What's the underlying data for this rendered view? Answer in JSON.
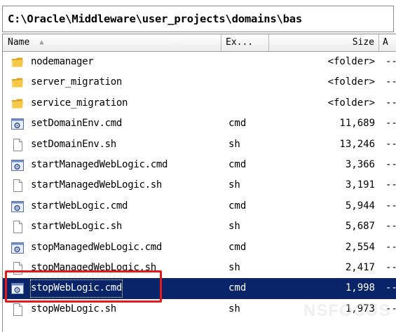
{
  "path_bar": {
    "text": "C:\\Oracle\\Middleware\\user_projects\\domains\\bas"
  },
  "columns": {
    "name": "Name",
    "ext": "Ex...",
    "size": "Size",
    "attr": "A"
  },
  "rows": [
    {
      "name": "nodemanager",
      "ext": "",
      "size": "<folder>",
      "attr": "--",
      "icon": "folder-icon"
    },
    {
      "name": "server_migration",
      "ext": "",
      "size": "<folder>",
      "attr": "--",
      "icon": "folder-icon"
    },
    {
      "name": "service_migration",
      "ext": "",
      "size": "<folder>",
      "attr": "--",
      "icon": "folder-icon"
    },
    {
      "name": "setDomainEnv.cmd",
      "ext": "cmd",
      "size": "11,689",
      "attr": "--",
      "icon": "gear-file-icon"
    },
    {
      "name": "setDomainEnv.sh",
      "ext": "sh",
      "size": "13,246",
      "attr": "--",
      "icon": "blank-file-icon"
    },
    {
      "name": "startManagedWebLogic.cmd",
      "ext": "cmd",
      "size": "3,366",
      "attr": "--",
      "icon": "gear-file-icon"
    },
    {
      "name": "startManagedWebLogic.sh",
      "ext": "sh",
      "size": "3,191",
      "attr": "--",
      "icon": "blank-file-icon"
    },
    {
      "name": "startWebLogic.cmd",
      "ext": "cmd",
      "size": "5,944",
      "attr": "--",
      "icon": "gear-file-icon"
    },
    {
      "name": "startWebLogic.sh",
      "ext": "sh",
      "size": "5,687",
      "attr": "--",
      "icon": "blank-file-icon"
    },
    {
      "name": "stopManagedWebLogic.cmd",
      "ext": "cmd",
      "size": "2,554",
      "attr": "--",
      "icon": "gear-file-icon"
    },
    {
      "name": "stopManagedWebLogic.sh",
      "ext": "sh",
      "size": "2,417",
      "attr": "--",
      "icon": "blank-file-icon"
    },
    {
      "name": "stopWebLogic.cmd",
      "ext": "cmd",
      "size": "1,998",
      "attr": "--",
      "icon": "gear-file-icon",
      "selected": true
    },
    {
      "name": "stopWebLogic.sh",
      "ext": "sh",
      "size": "1,973",
      "attr": "--",
      "icon": "blank-file-icon"
    }
  ],
  "watermark": "NSFOCUS",
  "colors": {
    "selection": "#0a246a",
    "highlight_box": "#e21a1a",
    "folder": "#f2c23c"
  }
}
